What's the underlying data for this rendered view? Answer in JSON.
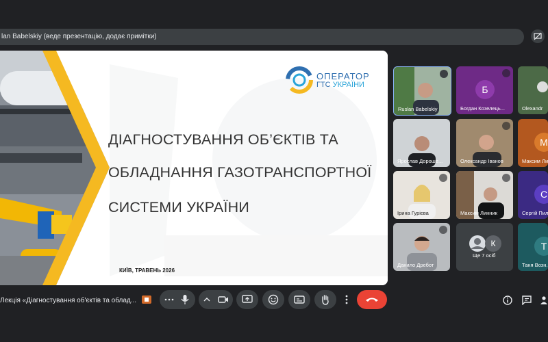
{
  "presenter_bar": {
    "text": "lan Babelskiy (веде презентацію, додає примітки)"
  },
  "slide": {
    "logo_line1": "ОПЕРАТОР",
    "logo_line2a": "ГТС ",
    "logo_line2b": "УКРАЇНИ",
    "title_lines": [
      "ДІАГНОСТУВАННЯ ОБ’ЄКТІВ ТА",
      "ОБЛАДНАННЯ ГАЗОТРАНСПОРТНОЇ",
      "СИСТЕМИ УКРАЇНИ"
    ],
    "place_date": "КИЇВ,  ТРАВЕНЬ 2026"
  },
  "participants": [
    {
      "name": "Ruslan Babelskiy"
    },
    {
      "name": "Богдан Козелець...",
      "initial": "Б"
    },
    {
      "name": "Olexandr"
    },
    {
      "name": "Ярослав Дороше..."
    },
    {
      "name": "Олександр Іванов"
    },
    {
      "name": "Максим Ли...",
      "initial": "М"
    },
    {
      "name": "Ірина Гурієва"
    },
    {
      "name": "Максим Линник"
    },
    {
      "name": "Сергій Пил...",
      "initial": "С"
    },
    {
      "name": "Данило Дребот"
    },
    {
      "name": "Ще 7 осіб",
      "initial": "К"
    },
    {
      "name": "Таня Возн...",
      "initial": "Т"
    }
  ],
  "controls": {
    "meeting_title": "Лекція «Діагностування об'єктів та облад..."
  },
  "colors": {
    "accent_orange": "#f5b921",
    "brand_blue": "#2f6fb0",
    "end_call": "#ea4335"
  }
}
